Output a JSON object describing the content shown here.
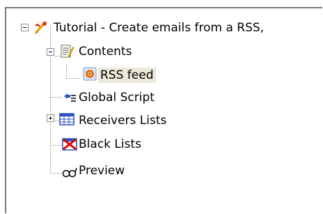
{
  "tree": {
    "root_label": "Tutorial - Create emails from a  RSS,",
    "contents_label": "Contents",
    "rss_feed_label": "RSS feed",
    "global_script_label": "Global Script",
    "receivers_lists_label": "Receivers Lists",
    "black_lists_label": "Black Lists",
    "preview_label": "Preview"
  },
  "icons": {
    "root": "tutorial-wand-icon",
    "contents": "notepad-icon",
    "rss_feed": "rss-feed-icon",
    "global_script": "script-icon",
    "receivers_lists": "table-icon",
    "black_lists": "blacklist-icon",
    "preview": "glasses-icon"
  }
}
